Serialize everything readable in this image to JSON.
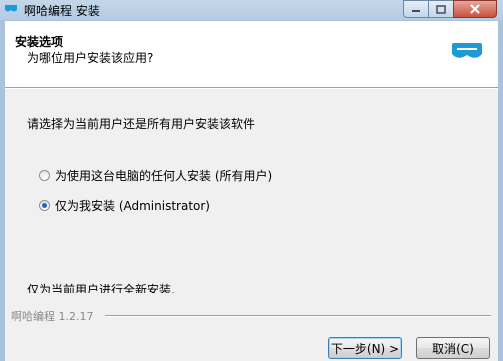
{
  "window": {
    "title": "啊哈编程 安装"
  },
  "header": {
    "title": "安装选项",
    "subtitle": "为哪位用户安装该应用?"
  },
  "content": {
    "instruction": "请选择为当前用户还是所有用户安装该软件",
    "options": [
      {
        "label": "为使用这台电脑的任何人安装 (所有用户)",
        "checked": false
      },
      {
        "label": "仅为我安装 (Administrator)",
        "checked": true
      }
    ],
    "note": "仅为当前用户进行全新安装."
  },
  "footer": {
    "version": "啊哈编程 1.2.17",
    "next_label": "下一步(N) >",
    "cancel_label": "取消(C)"
  },
  "colors": {
    "logo_blue": "#1e9bd7",
    "radio_dot": "#2a63b8"
  }
}
